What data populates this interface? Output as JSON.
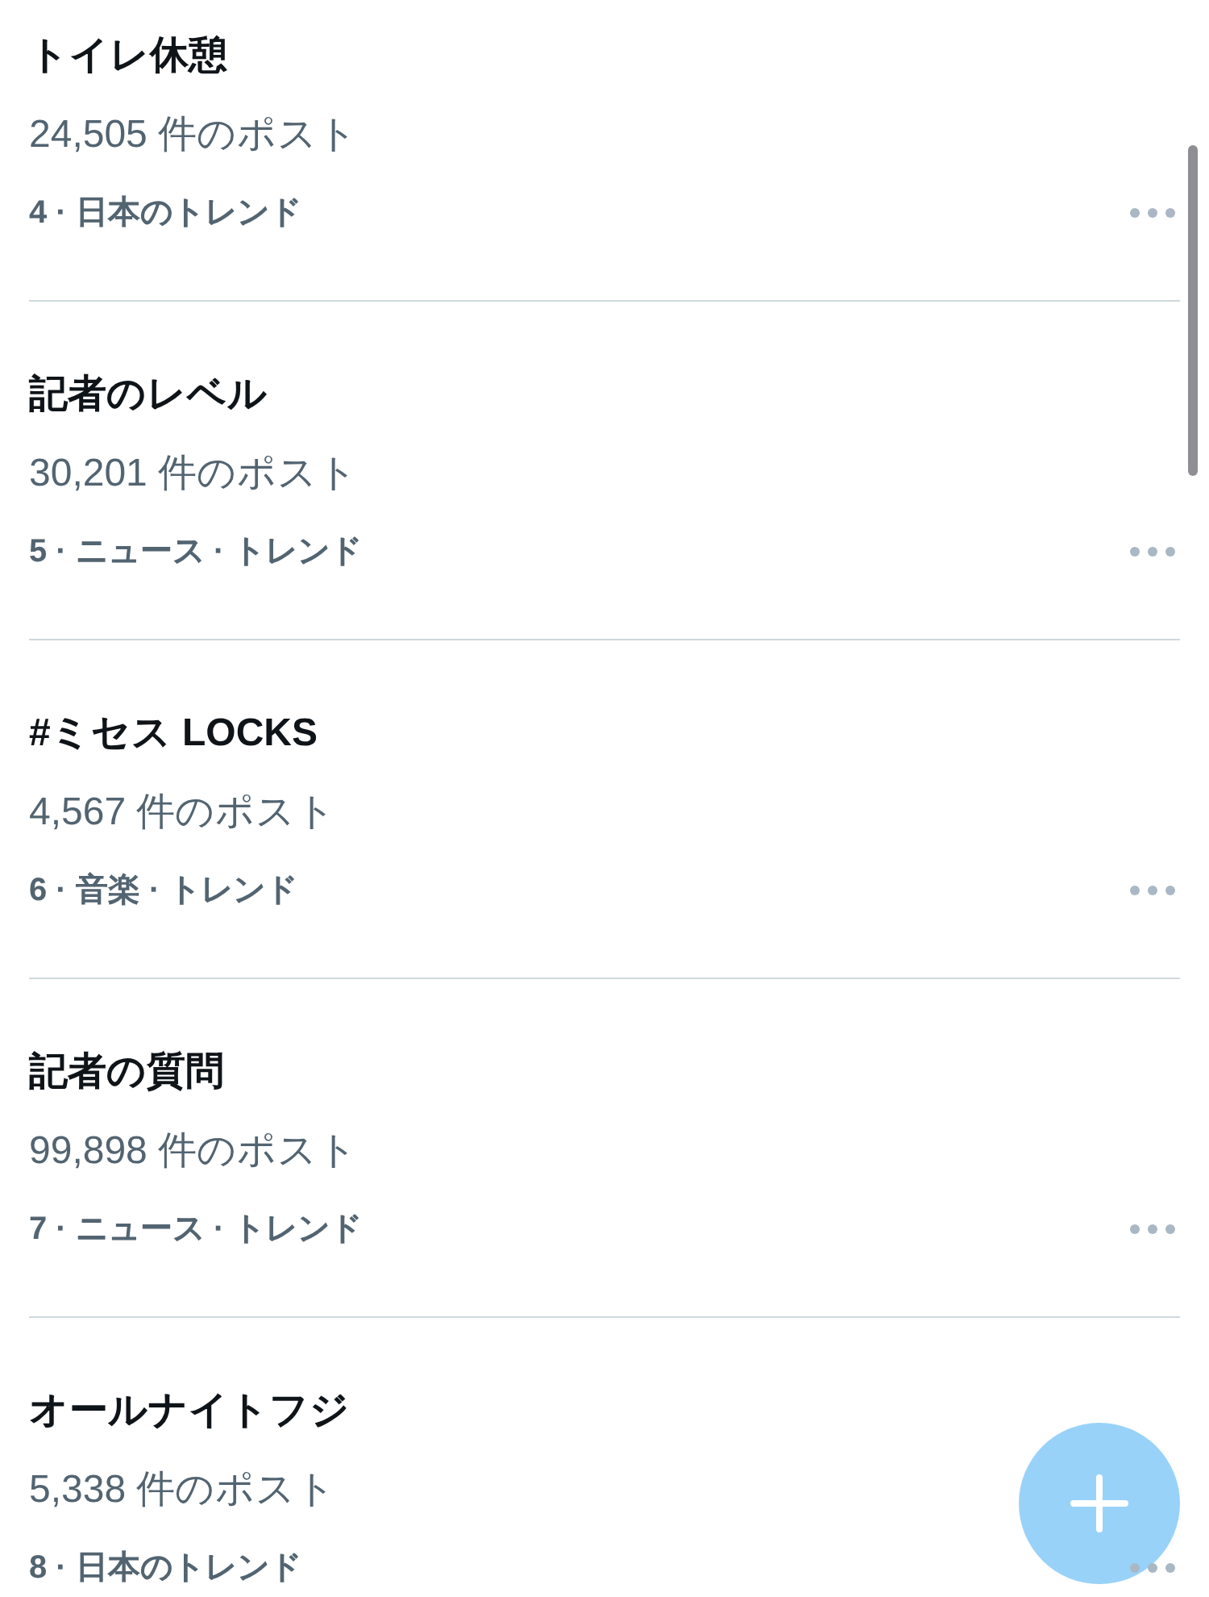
{
  "trends": [
    {
      "title": "トイレ休憩",
      "posts": "24,505 件のポスト",
      "meta": "4 · 日本のトレンド"
    },
    {
      "title": "記者のレベル",
      "posts": "30,201 件のポスト",
      "meta": "5 · ニュース · トレンド"
    },
    {
      "title": "#ミセス LOCKS",
      "posts": "4,567 件のポスト",
      "meta": "6 · 音楽 · トレンド"
    },
    {
      "title": "記者の質問",
      "posts": "99,898 件のポスト",
      "meta": "7 · ニュース · トレンド"
    },
    {
      "title": "オールナイトフジ",
      "posts": "5,338 件のポスト",
      "meta": "8 · 日本のトレンド"
    }
  ]
}
